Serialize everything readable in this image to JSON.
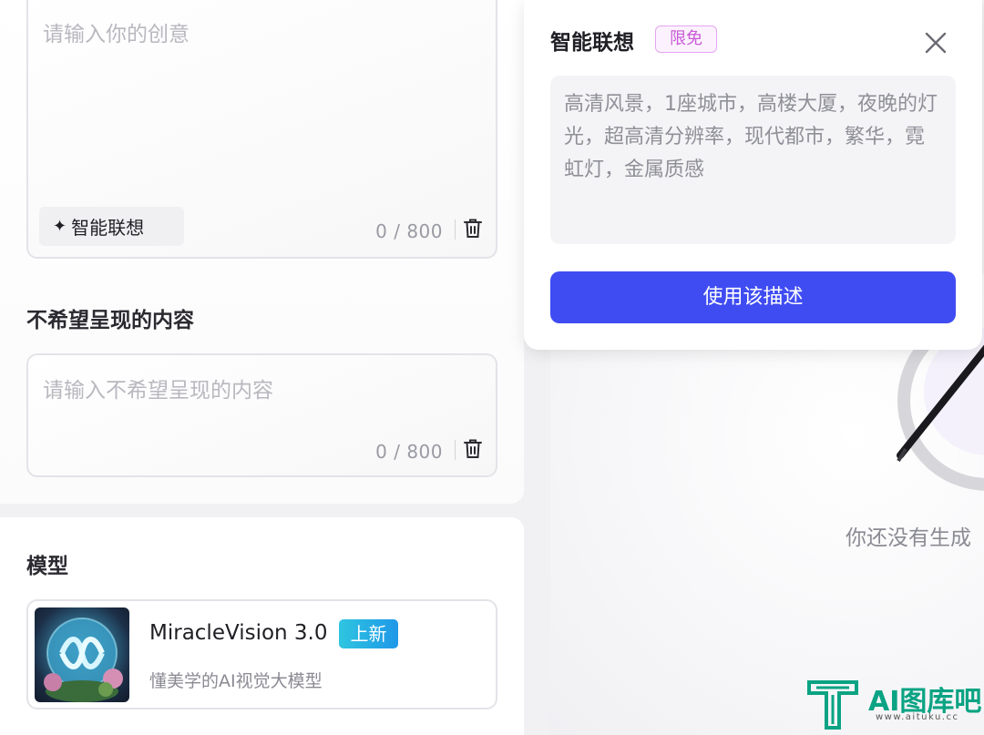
{
  "prompt": {
    "placeholder": "请输入你的创意",
    "assist_label": "智能联想",
    "counter": "0 / 800"
  },
  "negative": {
    "label": "不希望呈现的内容",
    "placeholder": "请输入不希望呈现的内容",
    "counter": "0 / 800"
  },
  "model": {
    "section_label": "模型",
    "name": "MiracleVision 3.0",
    "badge": "上新",
    "description": "懂美学的AI视觉大模型"
  },
  "result": {
    "empty_text": "你还没有生成"
  },
  "popover": {
    "title": "智能联想",
    "badge": "限免",
    "suggestion": "高清风景，1座城市，高楼大厦，夜晚的灯光，超高清分辨率，现代都市，繁华，霓虹灯，金属质感",
    "use_button": "使用该描述"
  },
  "watermark": {
    "text": "AI图库吧",
    "url": "www.aituku.cc"
  },
  "colors": {
    "primary_button": "#3f4cf2",
    "free_badge": "#c85ad6",
    "new_badge": "#1f98e8"
  }
}
